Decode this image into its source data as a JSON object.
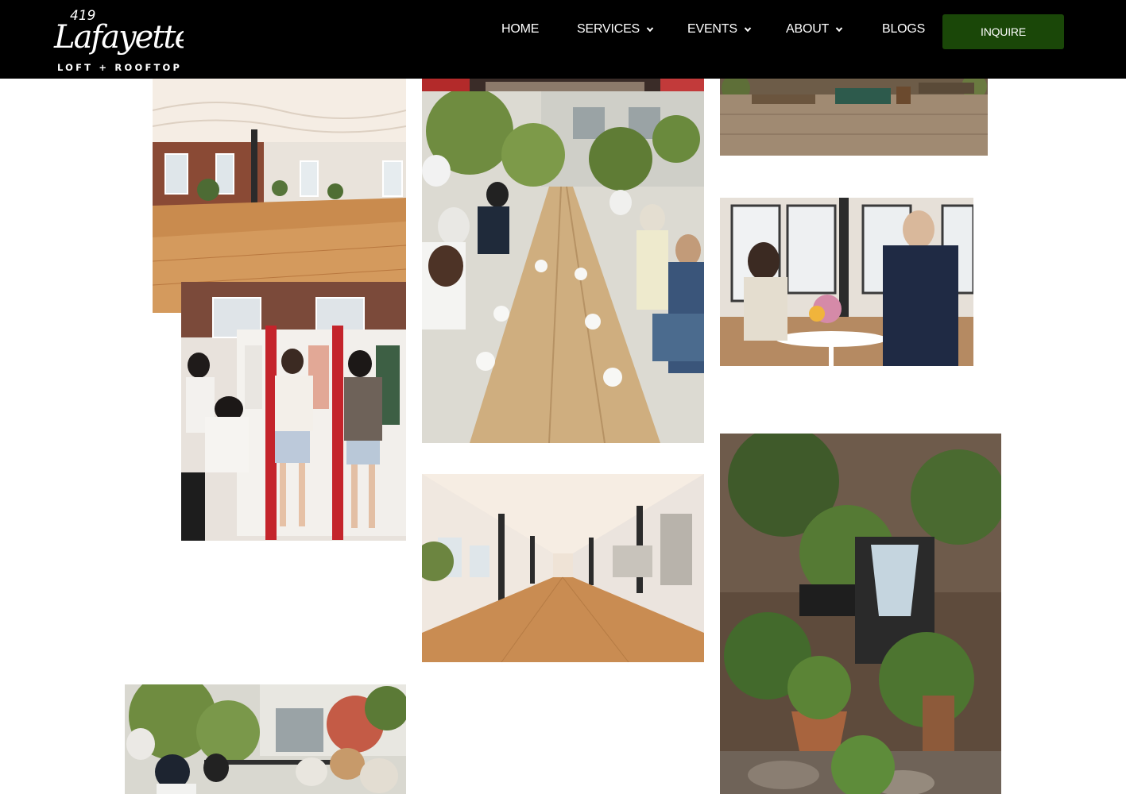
{
  "brand": {
    "number": "419",
    "name": "Lafayette",
    "tagline": "LOFT + ROOFTOP"
  },
  "nav": {
    "items": [
      {
        "label": "HOME",
        "has_dropdown": false
      },
      {
        "label": "SERVICES",
        "has_dropdown": true
      },
      {
        "label": "EVENTS",
        "has_dropdown": true
      },
      {
        "label": "ABOUT",
        "has_dropdown": true
      },
      {
        "label": "BLOGS",
        "has_dropdown": false
      }
    ],
    "cta_label": "INQUIRE"
  },
  "colors": {
    "header_bg": "#000000",
    "cta_bg": "#1a4708",
    "text": "#ffffff"
  },
  "gallery": [
    {
      "name": "loft-empty-room"
    },
    {
      "name": "dinner-table-event"
    },
    {
      "name": "rooftop-deck"
    },
    {
      "name": "guests-conversation"
    },
    {
      "name": "clothing-lockers"
    },
    {
      "name": "loft-long-hall"
    },
    {
      "name": "plants-fountain"
    },
    {
      "name": "rooftop-guests"
    }
  ]
}
